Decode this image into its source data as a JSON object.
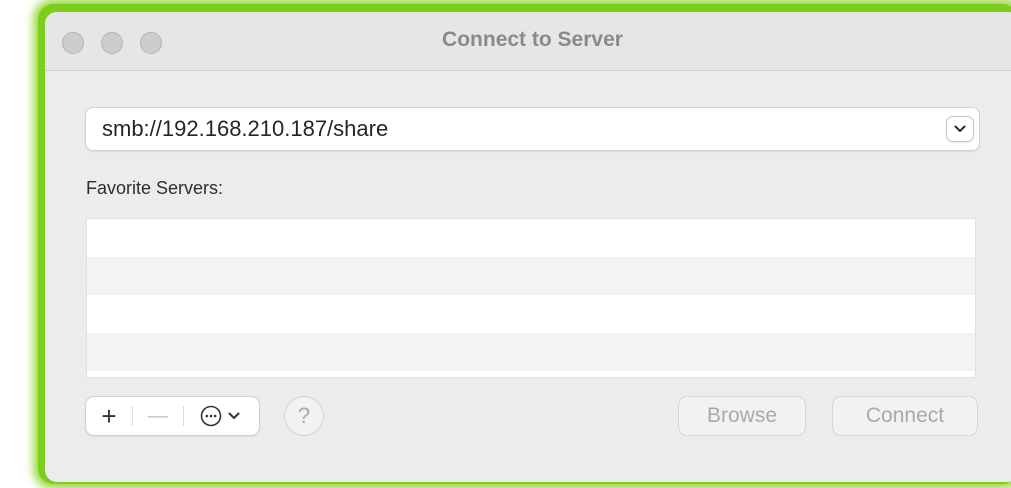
{
  "window": {
    "title": "Connect to Server"
  },
  "server_address": {
    "value": "smb://192.168.210.187/share"
  },
  "favorites": {
    "label": "Favorite Servers:",
    "items": []
  },
  "toolbar": {
    "add_label": "+",
    "remove_label": "—",
    "help_label": "?"
  },
  "buttons": {
    "browse_label": "Browse",
    "connect_label": "Connect"
  },
  "icons": {
    "dropdown": "chevron-down-icon",
    "more": "ellipsis-circle-icon"
  },
  "colors": {
    "highlight_border": "#7ccd1c",
    "window_bg": "#ececec",
    "disabled_text": "#a9a9a9"
  }
}
